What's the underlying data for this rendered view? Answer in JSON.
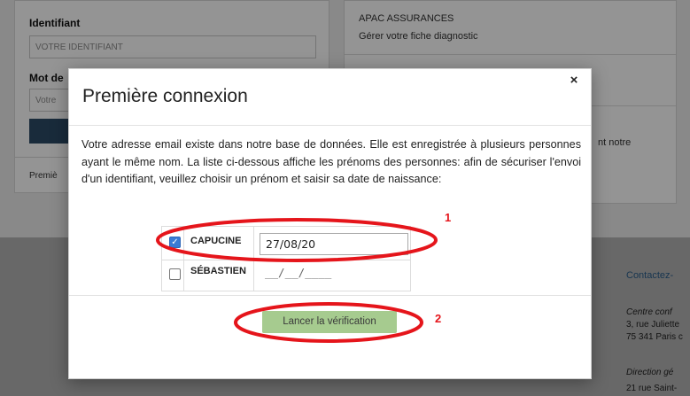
{
  "background": {
    "login": {
      "identifiant_label": "Identifiant",
      "identifiant_placeholder": "VOTRE IDENTIFIANT",
      "password_label": "Mot de",
      "password_placeholder": "Votre",
      "first_connection_link": "Premiè"
    },
    "info": {
      "apac_title": "APAC ASSURANCES",
      "apac_sub": "Gérer votre fiche diagnostic",
      "tail_text": "nt notre"
    },
    "footer": {
      "contact": "Contactez-",
      "centre": "Centre conf",
      "addr1": "3, rue Juliette",
      "addr2": "75 341 Paris c",
      "direction": "Direction gé",
      "addr3": "21 rue Saint-"
    }
  },
  "modal": {
    "title": "Première connexion",
    "close_icon": "×",
    "message": "Votre adresse email existe dans notre base de données. Elle est enregistrée à plusieurs personnes ayant le même nom. La liste ci-dessous affiche les prénoms des personnes: afin de sécuriser l'envoi d'un identifiant, veuillez choisir un prénom et saisir sa date de naissance:",
    "persons": [
      {
        "name": "CAPUCINE",
        "checked": true,
        "date_value": "27/08/20"
      },
      {
        "name": "SÉBASTIEN",
        "checked": false,
        "date_mask": "__/__/____"
      }
    ],
    "verify_button": "Lancer la vérification"
  },
  "annotations": {
    "label_1": "1",
    "label_2": "2",
    "color": "#e5151b"
  },
  "colors": {
    "verify_button_bg": "#a6cb8f",
    "checkbox_checked": "#3a7bd5",
    "annotation_red": "#e5151b"
  }
}
